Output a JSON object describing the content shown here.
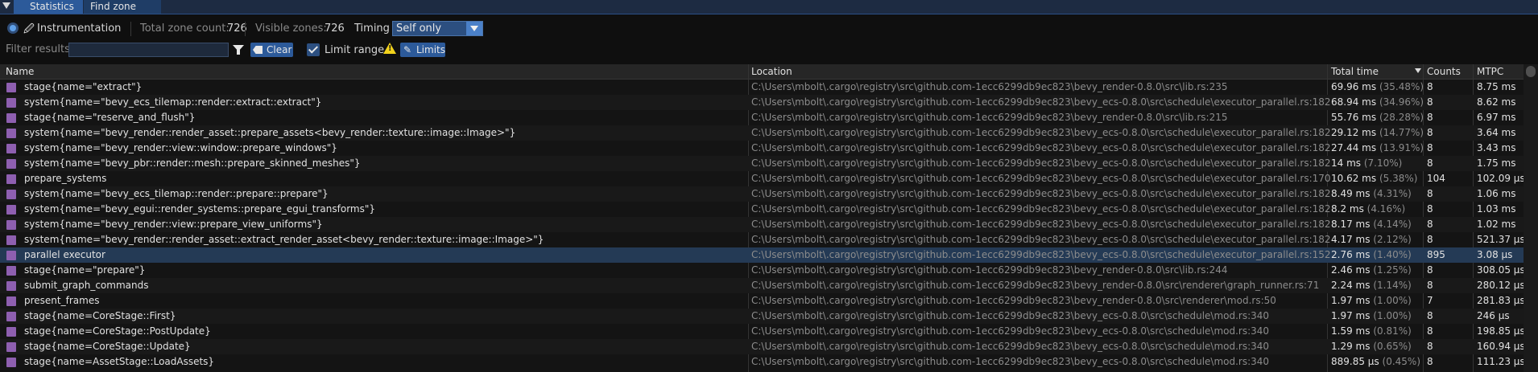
{
  "tabs": {
    "statistics": "Statistics",
    "find_zone": "Find zone"
  },
  "toolbar": {
    "mode_label": "Instrumentation",
    "total_zone_label": "Total zone count:",
    "total_zone_value": "726",
    "visible_zone_label": "Visible zones:",
    "visible_zone_value": "726",
    "timing_label": "Timing",
    "timing_value": "Self only",
    "filter_label": "Filter results",
    "filter_value": "",
    "clear_label": "Clear",
    "limit_range_label": "Limit range",
    "limits_label": "Limits"
  },
  "table": {
    "headers": {
      "name": "Name",
      "location": "Location",
      "total_time": "Total time",
      "counts": "Counts",
      "mtpc": "MTPC"
    },
    "rows": [
      {
        "name": "stage{name=\"extract\"}",
        "location": "C:\\Users\\mbolt\\.cargo\\registry\\src\\github.com-1ecc6299db9ec823\\bevy_render-0.8.0\\src\\lib.rs:235",
        "time": "69.96 ms",
        "pct": "(35.48%)",
        "count": "8",
        "mtpc": "8.75 ms"
      },
      {
        "name": "system{name=\"bevy_ecs_tilemap::render::extract::extract\"}",
        "location": "C:\\Users\\mbolt\\.cargo\\registry\\src\\github.com-1ecc6299db9ec823\\bevy_ecs-0.8.0\\src\\schedule\\executor_parallel.rs:182",
        "time": "68.94 ms",
        "pct": "(34.96%)",
        "count": "8",
        "mtpc": "8.62 ms"
      },
      {
        "name": "stage{name=\"reserve_and_flush\"}",
        "location": "C:\\Users\\mbolt\\.cargo\\registry\\src\\github.com-1ecc6299db9ec823\\bevy_render-0.8.0\\src\\lib.rs:215",
        "time": "55.76 ms",
        "pct": "(28.28%)",
        "count": "8",
        "mtpc": "6.97 ms"
      },
      {
        "name": "system{name=\"bevy_render::render_asset::prepare_assets<bevy_render::texture::image::Image>\"}",
        "location": "C:\\Users\\mbolt\\.cargo\\registry\\src\\github.com-1ecc6299db9ec823\\bevy_ecs-0.8.0\\src\\schedule\\executor_parallel.rs:182",
        "time": "29.12 ms",
        "pct": "(14.77%)",
        "count": "8",
        "mtpc": "3.64 ms"
      },
      {
        "name": "system{name=\"bevy_render::view::window::prepare_windows\"}",
        "location": "C:\\Users\\mbolt\\.cargo\\registry\\src\\github.com-1ecc6299db9ec823\\bevy_ecs-0.8.0\\src\\schedule\\executor_parallel.rs:182",
        "time": "27.44 ms",
        "pct": "(13.91%)",
        "count": "8",
        "mtpc": "3.43 ms"
      },
      {
        "name": "system{name=\"bevy_pbr::render::mesh::prepare_skinned_meshes\"}",
        "location": "C:\\Users\\mbolt\\.cargo\\registry\\src\\github.com-1ecc6299db9ec823\\bevy_ecs-0.8.0\\src\\schedule\\executor_parallel.rs:182",
        "time": "14 ms",
        "pct": "(7.10%)",
        "count": "8",
        "mtpc": "1.75 ms"
      },
      {
        "name": "prepare_systems",
        "location": "C:\\Users\\mbolt\\.cargo\\registry\\src\\github.com-1ecc6299db9ec823\\bevy_ecs-0.8.0\\src\\schedule\\executor_parallel.rs:170",
        "time": "10.62 ms",
        "pct": "(5.38%)",
        "count": "104",
        "mtpc": "102.09 µs"
      },
      {
        "name": "system{name=\"bevy_ecs_tilemap::render::prepare::prepare\"}",
        "location": "C:\\Users\\mbolt\\.cargo\\registry\\src\\github.com-1ecc6299db9ec823\\bevy_ecs-0.8.0\\src\\schedule\\executor_parallel.rs:182",
        "time": "8.49 ms",
        "pct": "(4.31%)",
        "count": "8",
        "mtpc": "1.06 ms"
      },
      {
        "name": "system{name=\"bevy_egui::render_systems::prepare_egui_transforms\"}",
        "location": "C:\\Users\\mbolt\\.cargo\\registry\\src\\github.com-1ecc6299db9ec823\\bevy_ecs-0.8.0\\src\\schedule\\executor_parallel.rs:182",
        "time": "8.2 ms",
        "pct": "(4.16%)",
        "count": "8",
        "mtpc": "1.03 ms"
      },
      {
        "name": "system{name=\"bevy_render::view::prepare_view_uniforms\"}",
        "location": "C:\\Users\\mbolt\\.cargo\\registry\\src\\github.com-1ecc6299db9ec823\\bevy_ecs-0.8.0\\src\\schedule\\executor_parallel.rs:182",
        "time": "8.17 ms",
        "pct": "(4.14%)",
        "count": "8",
        "mtpc": "1.02 ms"
      },
      {
        "name": "system{name=\"bevy_render::render_asset::extract_render_asset<bevy_render::texture::image::Image>\"}",
        "location": "C:\\Users\\mbolt\\.cargo\\registry\\src\\github.com-1ecc6299db9ec823\\bevy_ecs-0.8.0\\src\\schedule\\executor_parallel.rs:182",
        "time": "4.17 ms",
        "pct": "(2.12%)",
        "count": "8",
        "mtpc": "521.37 µs"
      },
      {
        "name": "parallel executor",
        "location": "C:\\Users\\mbolt\\.cargo\\registry\\src\\github.com-1ecc6299db9ec823\\bevy_ecs-0.8.0\\src\\schedule\\executor_parallel.rs:152",
        "time": "2.76 ms",
        "pct": "(1.40%)",
        "count": "895",
        "mtpc": "3.08 µs",
        "selected": true
      },
      {
        "name": "stage{name=\"prepare\"}",
        "location": "C:\\Users\\mbolt\\.cargo\\registry\\src\\github.com-1ecc6299db9ec823\\bevy_render-0.8.0\\src\\lib.rs:244",
        "time": "2.46 ms",
        "pct": "(1.25%)",
        "count": "8",
        "mtpc": "308.05 µs"
      },
      {
        "name": "submit_graph_commands",
        "location": "C:\\Users\\mbolt\\.cargo\\registry\\src\\github.com-1ecc6299db9ec823\\bevy_render-0.8.0\\src\\renderer\\graph_runner.rs:71",
        "time": "2.24 ms",
        "pct": "(1.14%)",
        "count": "8",
        "mtpc": "280.12 µs"
      },
      {
        "name": "present_frames",
        "location": "C:\\Users\\mbolt\\.cargo\\registry\\src\\github.com-1ecc6299db9ec823\\bevy_render-0.8.0\\src\\renderer\\mod.rs:50",
        "time": "1.97 ms",
        "pct": "(1.00%)",
        "count": "7",
        "mtpc": "281.83 µs"
      },
      {
        "name": "stage{name=CoreStage::First}",
        "location": "C:\\Users\\mbolt\\.cargo\\registry\\src\\github.com-1ecc6299db9ec823\\bevy_ecs-0.8.0\\src\\schedule\\mod.rs:340",
        "time": "1.97 ms",
        "pct": "(1.00%)",
        "count": "8",
        "mtpc": "246 µs"
      },
      {
        "name": "stage{name=CoreStage::PostUpdate}",
        "location": "C:\\Users\\mbolt\\.cargo\\registry\\src\\github.com-1ecc6299db9ec823\\bevy_ecs-0.8.0\\src\\schedule\\mod.rs:340",
        "time": "1.59 ms",
        "pct": "(0.81%)",
        "count": "8",
        "mtpc": "198.85 µs"
      },
      {
        "name": "stage{name=CoreStage::Update}",
        "location": "C:\\Users\\mbolt\\.cargo\\registry\\src\\github.com-1ecc6299db9ec823\\bevy_ecs-0.8.0\\src\\schedule\\mod.rs:340",
        "time": "1.29 ms",
        "pct": "(0.65%)",
        "count": "8",
        "mtpc": "160.94 µs"
      },
      {
        "name": "stage{name=AssetStage::LoadAssets}",
        "location": "C:\\Users\\mbolt\\.cargo\\registry\\src\\github.com-1ecc6299db9ec823\\bevy_ecs-0.8.0\\src\\schedule\\mod.rs:340",
        "time": "889.85 µs",
        "pct": "(0.45%)",
        "count": "8",
        "mtpc": "111.23 µs"
      }
    ]
  },
  "colors": {
    "zone_color": "#8e5fb0",
    "accent": "#2c5a9a",
    "warning": "#f2d21c"
  }
}
